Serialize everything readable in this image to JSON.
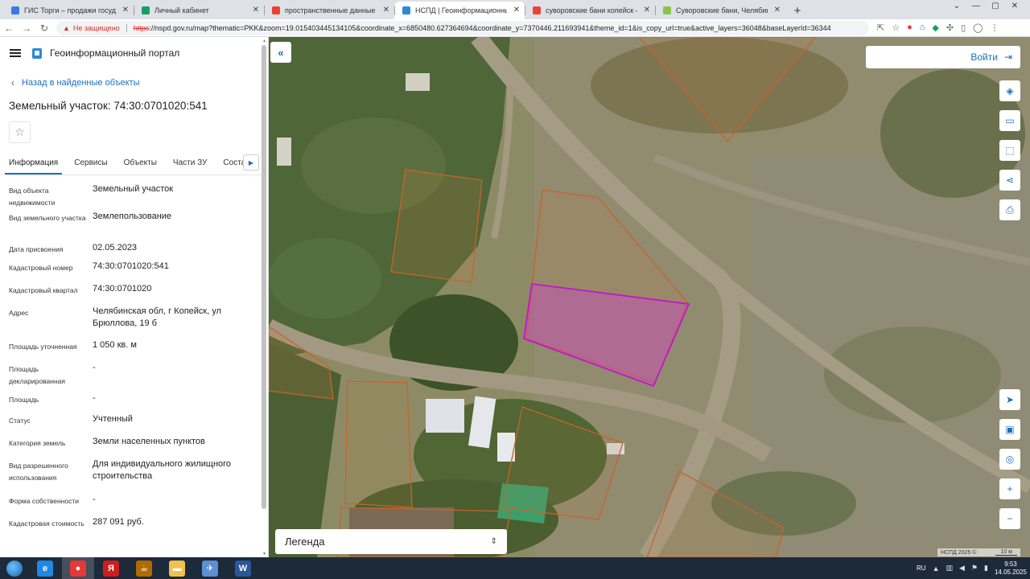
{
  "browser": {
    "tabs": [
      {
        "title": "ГИС Торги – продажи государст",
        "color": "#3b78e7",
        "active": false
      },
      {
        "title": "Личный кабинет",
        "color": "#1a9e5f",
        "active": false
      },
      {
        "title": "пространственные данные рос",
        "color": "#ea4335",
        "active": false
      },
      {
        "title": "НСПД | Геоинформационный п",
        "color": "#2c89d8",
        "active": true
      },
      {
        "title": "суворовские бани копейск — Я",
        "color": "#ea4335",
        "active": false
      },
      {
        "title": "Суворовские бани, Челябинская",
        "color": "#8bc34a",
        "active": false
      }
    ],
    "address": {
      "warning": "Не защищено",
      "scheme": "https",
      "rest": "://nspd.gov.ru/map?thematic=PKK&zoom=19.015403445134105&coordinate_x=6850480.627364694&coordinate_y=7370446.211693941&theme_id=1&is_copy_url=true&active_layers=36048&baseLayerId=36344"
    }
  },
  "panel": {
    "portal_title": "Геоинформационный портал",
    "back_label": "Назад в найденные объекты",
    "object_title": "Земельный участок: 74:30:0701020:541",
    "tabs": [
      "Информация",
      "Сервисы",
      "Объекты",
      "Части ЗУ",
      "Соста"
    ],
    "properties": [
      {
        "label": "Вид объекта недвижимости",
        "value": "Земельный участок"
      },
      {
        "label": "Вид земельного участка",
        "value": "Землепользование"
      },
      {
        "label": "Дата присвоения",
        "value": "02.05.2023"
      },
      {
        "label": "Кадастровый номер",
        "value": "74:30:0701020:541"
      },
      {
        "label": "Кадастровый квартал",
        "value": "74:30:0701020"
      },
      {
        "label": "Адрес",
        "value": "Челябинская обл, г Копейск, ул Брюллова, 19 б"
      },
      {
        "label": "Площадь уточненная",
        "value": "1 050 кв. м"
      },
      {
        "label": "Площадь декларированная",
        "value": "-"
      },
      {
        "label": "Площадь",
        "value": "-"
      },
      {
        "label": "Статус",
        "value": "Учтенный"
      },
      {
        "label": "Категория земель",
        "value": "Земли населенных пунктов"
      },
      {
        "label": "Вид разрешенного использования",
        "value": "Для индивидуального жилищного строительства"
      },
      {
        "label": "Форма собственности",
        "value": "-"
      },
      {
        "label": "Кадастровая стоимость",
        "value": "287 091 руб."
      }
    ]
  },
  "map": {
    "login_label": "Войти",
    "legend_label": "Легенда",
    "attribution": "НСПД 2025 ©",
    "scale_label": "10 м",
    "tools_top": [
      {
        "name": "layers-icon",
        "glyph": "◈"
      },
      {
        "name": "ruler-icon",
        "glyph": "▭"
      },
      {
        "name": "select-area-icon",
        "glyph": "⬚"
      },
      {
        "name": "share-icon",
        "glyph": "⋖"
      },
      {
        "name": "print-icon",
        "glyph": "⎙"
      }
    ],
    "tools_bottom": [
      {
        "name": "locate-icon",
        "glyph": "➤"
      },
      {
        "name": "minimap-icon",
        "glyph": "▣"
      },
      {
        "name": "geolocation-icon",
        "glyph": "◎"
      },
      {
        "name": "zoom-in-icon",
        "glyph": "+"
      },
      {
        "name": "zoom-out-icon",
        "glyph": "−"
      }
    ]
  },
  "taskbar": {
    "lang": "RU",
    "time": "9:53",
    "date": "14.05.2025",
    "apps": [
      {
        "name": "explorer-icon",
        "glyph": "e",
        "color": "#1e88e5"
      },
      {
        "name": "chrome-icon",
        "glyph": "●",
        "color": "#e53935"
      },
      {
        "name": "yandex-icon",
        "glyph": "Я",
        "color": "#cf1d1d"
      },
      {
        "name": "java-icon",
        "glyph": "☕",
        "color": "#b26a00"
      },
      {
        "name": "folder-icon",
        "glyph": "▬",
        "color": "#f2c04c"
      },
      {
        "name": "mail-icon",
        "glyph": "✈",
        "color": "#5b8fd6"
      },
      {
        "name": "word-icon",
        "glyph": "W",
        "color": "#2b579a"
      }
    ]
  }
}
